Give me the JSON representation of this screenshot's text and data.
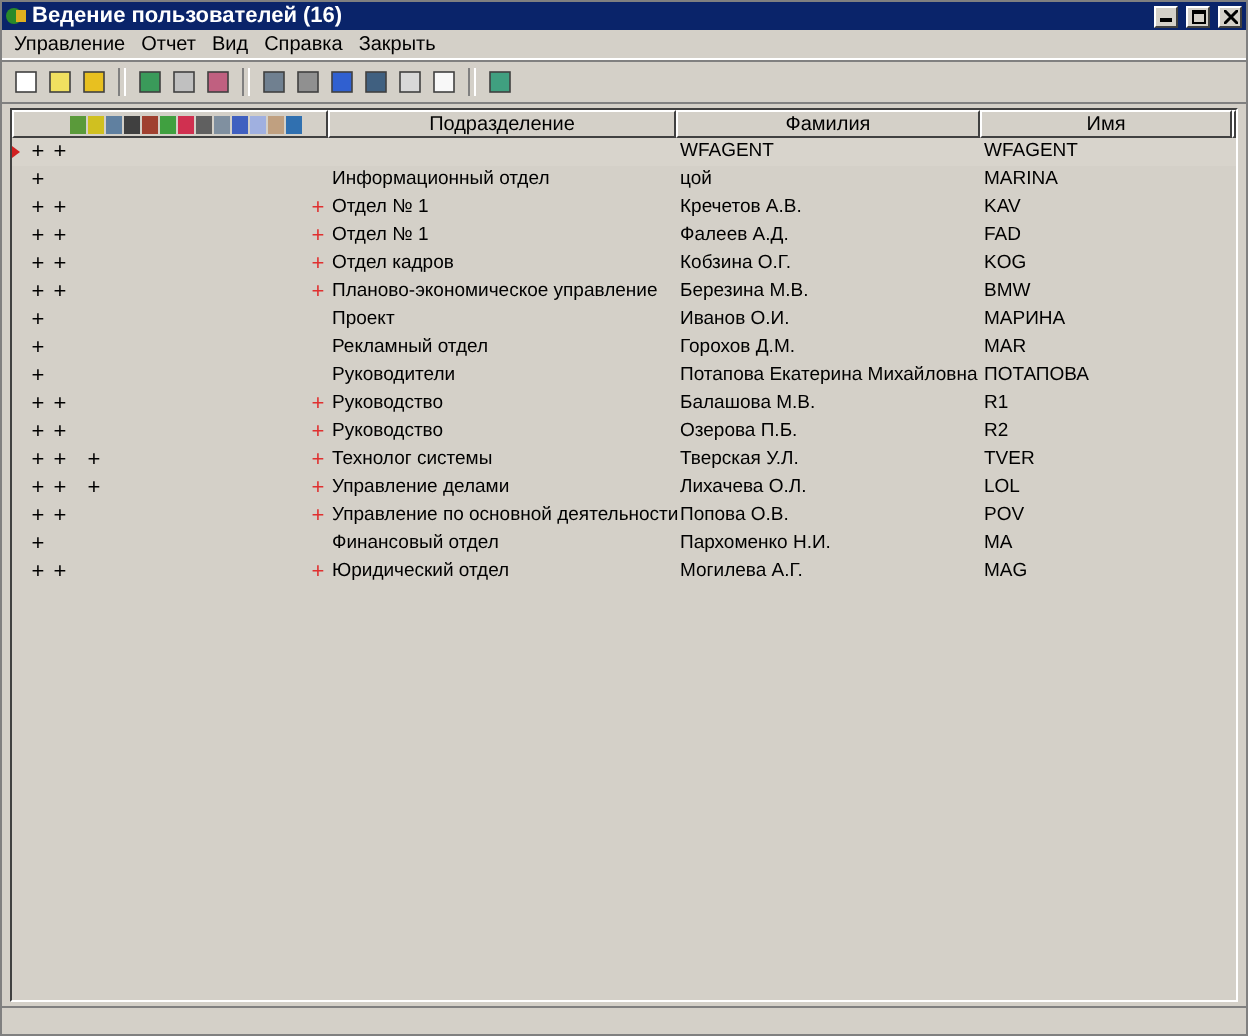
{
  "window": {
    "title": "Ведение пользователей (16)"
  },
  "menu": [
    "Управление",
    "Отчет",
    "Вид",
    "Справка",
    "Закрыть"
  ],
  "table": {
    "columns": [
      "Подразделение",
      "Фамилия",
      "Имя"
    ],
    "rows": [
      {
        "selected": true,
        "c1": "+",
        "c2": "+",
        "dept": "",
        "surname": "WFAGENT",
        "name": "WFAGENT"
      },
      {
        "selected": false,
        "c1": "+",
        "dept": "Информационный отдел",
        "surname": "цой",
        "name": "MARINA"
      },
      {
        "selected": false,
        "c1": "+",
        "c2": "+",
        "flag": "+",
        "dept": "Отдел № 1",
        "surname": "Кречетов А.В.",
        "name": "KAV"
      },
      {
        "selected": false,
        "c1": "+",
        "c2": "+",
        "flag": "+",
        "dept": "Отдел № 1",
        "surname": "Фалеев А.Д.",
        "name": "FAD"
      },
      {
        "selected": false,
        "c1": "+",
        "c2": "+",
        "flag": "+",
        "dept": "Отдел кадров",
        "surname": "Кобзина О.Г.",
        "name": "KOG"
      },
      {
        "selected": false,
        "c1": "+",
        "c2": "+",
        "flag": "+",
        "dept": "Планово-экономическое управление",
        "surname": "Березина М.В.",
        "name": "BMW"
      },
      {
        "selected": false,
        "c1": "+",
        "dept": "Проект",
        "surname": "Иванов О.И.",
        "name": "МАРИНА"
      },
      {
        "selected": false,
        "c1": "+",
        "dept": "Рекламный отдел",
        "surname": "Горохов Д.М.",
        "name": "MAR"
      },
      {
        "selected": false,
        "c1": "+",
        "dept": "Руководители",
        "surname": "Потапова Екатерина Михайловна",
        "name": "ПОТАПОВА"
      },
      {
        "selected": false,
        "c1": "+",
        "c2": "+",
        "flag": "+",
        "dept": "Руководство",
        "surname": "Балашова М.В.",
        "name": "R1"
      },
      {
        "selected": false,
        "c1": "+",
        "c2": "+",
        "flag": "+",
        "dept": "Руководство",
        "surname": "Озерова П.Б.",
        "name": "R2"
      },
      {
        "selected": false,
        "c1": "+",
        "c2": "+",
        "c3": "+",
        "flag": "+",
        "dept": "Технолог системы",
        "surname": "Тверская У.Л.",
        "name": "TVER"
      },
      {
        "selected": false,
        "c1": "+",
        "c2": "+",
        "c3": "+",
        "flag": "+",
        "dept": "Управление делами",
        "surname": "Лихачева О.Л.",
        "name": "LOL"
      },
      {
        "selected": false,
        "c1": "+",
        "c2": "+",
        "flag": "+",
        "dept": "Управление по основной деятельности",
        "surname": "Попова О.В.",
        "name": "POV"
      },
      {
        "selected": false,
        "c1": "+",
        "dept": "Финансовый отдел",
        "surname": "Пархоменко Н.И.",
        "name": "MA"
      },
      {
        "selected": false,
        "c1": "+",
        "c2": "+",
        "flag": "+",
        "dept": "Юридический отдел",
        "surname": "Могилева А.Г.",
        "name": "MAG"
      }
    ]
  }
}
